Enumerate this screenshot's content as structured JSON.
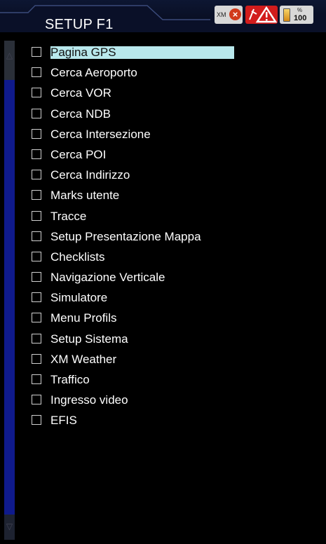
{
  "header": {
    "title": "SETUP F1",
    "status": {
      "xm_label": "XM",
      "xm_icon": "x-error-icon",
      "alert_icon": "warning-triangle-icon",
      "battery_unit": "%",
      "battery_value": "100"
    }
  },
  "menu": {
    "items": [
      {
        "label": "Pagina GPS",
        "checked": false,
        "selected": true
      },
      {
        "label": "Cerca Aeroporto",
        "checked": false
      },
      {
        "label": "Cerca VOR",
        "checked": false
      },
      {
        "label": "Cerca NDB",
        "checked": false
      },
      {
        "label": "Cerca Intersezione",
        "checked": false
      },
      {
        "label": "Cerca POI",
        "checked": false
      },
      {
        "label": "Cerca Indirizzo",
        "checked": false
      },
      {
        "label": "Marks utente",
        "checked": false
      },
      {
        "label": "Tracce",
        "checked": false
      },
      {
        "label": "Setup Presentazione Mappa",
        "checked": false
      },
      {
        "label": "Checklists",
        "checked": false
      },
      {
        "label": "Navigazione Verticale",
        "checked": false
      },
      {
        "label": "Simulatore",
        "checked": false
      },
      {
        "label": "Menu Profils",
        "checked": false
      },
      {
        "label": "Setup Sistema",
        "checked": false
      },
      {
        "label": "XM Weather",
        "checked": false
      },
      {
        "label": "Traffico",
        "checked": false
      },
      {
        "label": "Ingresso video",
        "checked": false
      },
      {
        "label": "EFIS",
        "checked": false
      }
    ]
  },
  "colors": {
    "background": "#000000",
    "highlight": "#b8e8ec",
    "scroll_track": "#0f1a8c",
    "alert": "#d21c1c"
  }
}
